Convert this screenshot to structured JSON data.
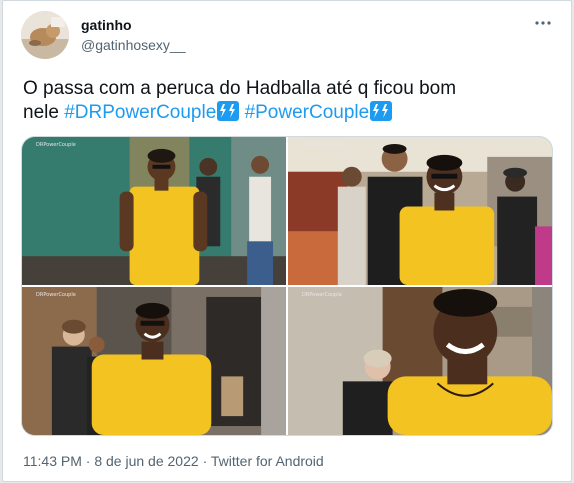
{
  "user": {
    "name": "gatinho",
    "handle": "@gatinhosexy__"
  },
  "tweet": {
    "text_line1": "O passa com a peruca do Hadballa até q ficou bom",
    "text_line2_prefix": "nele ",
    "hashtag1": "#DRPowerCouple",
    "hashtag2": "#PowerCouple",
    "emoji": "high-voltage-emoji"
  },
  "media": {
    "watermark": "DRPowerCouple",
    "photos": [
      {
        "scene": "man in yellow shirt walking in green room"
      },
      {
        "scene": "man in yellow shirt laughing in kitchen"
      },
      {
        "scene": "man in yellow shirt near doorway"
      },
      {
        "scene": "close up man in yellow shirt smiling"
      }
    ]
  },
  "meta": {
    "time": "11:43 PM",
    "separator": "·",
    "date": "8 de jun de 2022",
    "source": "Twitter for Android"
  },
  "colors": {
    "link": "#1d9bf0",
    "secondary_text": "#536471",
    "shirt": "#f2c321"
  }
}
